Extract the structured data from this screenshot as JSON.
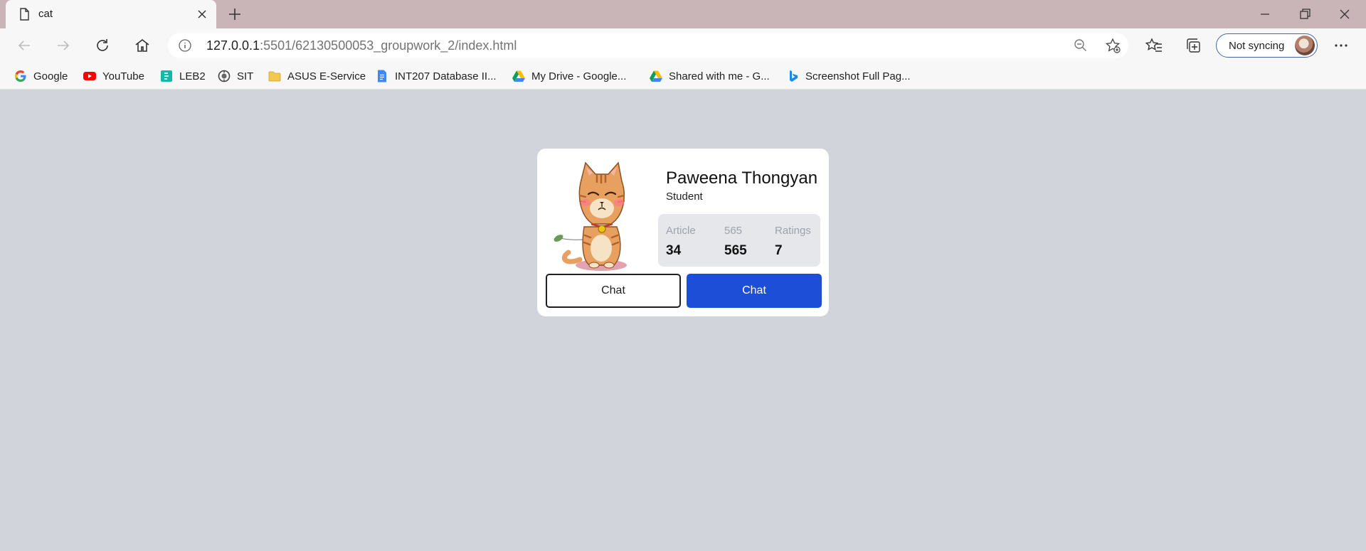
{
  "browser": {
    "tab_title": "cat",
    "url_host": "127.0.0.1",
    "url_rest": ":5501/62130500053_groupwork_2/index.html",
    "sync_label": "Not syncing"
  },
  "bookmarks": [
    {
      "label": "Google",
      "icon": "google-icon"
    },
    {
      "label": "YouTube",
      "icon": "youtube-icon"
    },
    {
      "label": "LEB2",
      "icon": "leb2-icon"
    },
    {
      "label": "SIT",
      "icon": "sit-icon"
    },
    {
      "label": "ASUS E-Service",
      "icon": "folder-icon"
    },
    {
      "label": "INT207 Database II...",
      "icon": "google-docs-icon"
    },
    {
      "label": "My Drive - Google...",
      "icon": "google-drive-icon"
    },
    {
      "label": "Shared with me - G...",
      "icon": "google-drive-icon"
    },
    {
      "label": "Screenshot Full Pag...",
      "icon": "bing-icon"
    }
  ],
  "profile": {
    "name": "Paweena Thongyan",
    "role": "Student",
    "stats": [
      {
        "label": "Article",
        "value": "34"
      },
      {
        "label": "565",
        "value": "565"
      },
      {
        "label": "Ratings",
        "value": "7"
      }
    ],
    "buttons": {
      "secondary": "Chat",
      "primary": "Chat"
    }
  },
  "colors": {
    "page_background": "#d1d5db",
    "card_background": "#ffffff",
    "stats_background": "#e5e7eb",
    "primary_button": "#1d4ed8",
    "tabstrip": "#c9b4b7"
  }
}
